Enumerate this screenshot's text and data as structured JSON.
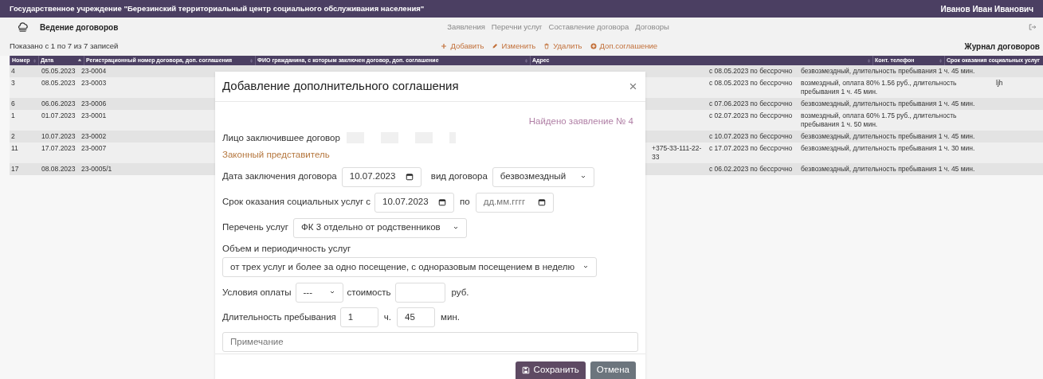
{
  "header": {
    "org": "Государственное учреждение \"Березинский территориальный центр социального обслуживания населения\"",
    "user": "Иванов Иван Иванович"
  },
  "nav": {
    "title": "Ведение договоров",
    "links": [
      "Заявления",
      "Перечни услуг",
      "Составление договора",
      "Договоры"
    ]
  },
  "toolbar": {
    "info": "Показано с 1 по 7 из 7 записей",
    "actions": [
      {
        "kind": "add",
        "label": "Добавить"
      },
      {
        "kind": "edit",
        "label": "Изменить"
      },
      {
        "kind": "delete",
        "label": "Удалить"
      },
      {
        "kind": "addendum",
        "label": "Доп.соглашение"
      }
    ],
    "journal": "Журнал договоров"
  },
  "table": {
    "columns": [
      {
        "label": "Номер",
        "sorted": false
      },
      {
        "label": "Дата",
        "sorted": true
      },
      {
        "label": "Регистрационный номер договора, доп. соглашения",
        "sorted": false
      },
      {
        "label": "ФИО гражданина, с которым заключен договор, доп. соглашение",
        "sorted": false
      },
      {
        "label": "Адрес",
        "sorted": false
      },
      {
        "label": "Конт. телефон",
        "sorted": false
      },
      {
        "label": "Срок оказания социальных услуг"
      }
    ],
    "rows": [
      {
        "number": "4",
        "date": "05.05.2023",
        "reg_no": "23-0004",
        "phone": "",
        "period": "с 08.05.2023 по бессрочно",
        "terms": "безвозмездный, длительность пребывания 1 ч. 45 мин.",
        "column_7": ""
      },
      {
        "number": "3",
        "date": "08.05.2023",
        "reg_no": "23-0003",
        "phone": "",
        "period": "с 08.05.2023 по бессрочно",
        "terms": "возмездный, оплата 80% 1.56 руб., длительность пребывания 1 ч. 45 мин.",
        "column_7": "ljh"
      },
      {
        "number": "6",
        "date": "06.06.2023",
        "reg_no": "23-0006",
        "phone": "",
        "period": "с 07.06.2023 по бессрочно",
        "terms": "безвозмездный, длительность пребывания 1 ч. 45 мин.",
        "column_7": ""
      },
      {
        "number": "1",
        "date": "01.07.2023",
        "reg_no": "23-0001",
        "phone": "",
        "period": "с 02.07.2023 по бессрочно",
        "terms": "возмездный, оплата 60% 1.75 руб., длительность пребывания 1 ч. 50 мин.",
        "column_7": ""
      },
      {
        "number": "2",
        "date": "10.07.2023",
        "reg_no": "23-0002",
        "phone": "",
        "period": "с 10.07.2023 по бессрочно",
        "terms": "безвозмездный, длительность пребывания 1 ч. 45 мин.",
        "column_7": ""
      },
      {
        "number": "11",
        "date": "17.07.2023",
        "reg_no": "23-0007",
        "phone": "+375-33-111-22-33",
        "period": "с 17.07.2023 по бессрочно",
        "terms": "безвозмездный, длительность пребывания 1 ч. 30 мин.",
        "column_7": ""
      },
      {
        "number": "17",
        "date": "08.08.2023",
        "reg_no": "23-0005/1",
        "phone": "",
        "period": "с 06.02.2023 по бессрочно",
        "terms": "безвозмездный, длительность пребывания 1 ч. 45 мин.",
        "column_7": ""
      }
    ]
  },
  "modal": {
    "title": "Добавление дополнительного соглашения",
    "found": "Найдено заявление № 4",
    "person_label": "Лицо заключившее договор",
    "representative_link": "Законный представитель",
    "contract_date": {
      "label": "Дата заключения договора",
      "value": "10.07.2023"
    },
    "contract_type": {
      "label": "вид договора",
      "value": "безвозмездный"
    },
    "service_period": {
      "label": "Срок оказания социальных услуг с",
      "from": "10.07.2023",
      "to_label": "по",
      "to_placeholder": "дд.мм.гггг"
    },
    "service_list": {
      "label": "Перечень услуг",
      "value": "ФК 3 отдельно от родственников"
    },
    "volume": {
      "label": "Объем и периодичность услуг",
      "value": "от трех услуг и более за одно посещение, с одноразовым посещением в неделю"
    },
    "payment": {
      "label": "Условия оплаты",
      "value": "---",
      "cost_label": "стоимость",
      "cost_unit": "руб."
    },
    "duration": {
      "label": "Длительность пребывания",
      "hours": "1",
      "hours_unit": "ч.",
      "minutes": "45",
      "minutes_unit": "мин."
    },
    "note": {
      "placeholder": "Примечание"
    },
    "buttons": [
      {
        "kind": "save",
        "label": "Сохранить"
      },
      {
        "kind": "cancel",
        "label": "Отмена"
      }
    ]
  }
}
